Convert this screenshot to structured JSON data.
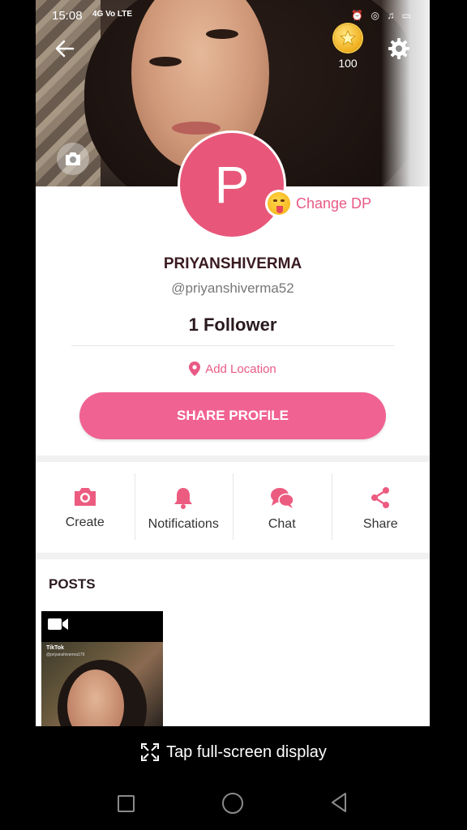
{
  "status": {
    "time": "15:08",
    "network": "4G Vo LTE",
    "right_icons": "⏰ ◎ ♫ ▭"
  },
  "coins": {
    "count": "100"
  },
  "profile": {
    "avatar_letter": "P",
    "change_dp_label": "Change DP",
    "name": "PRIYANSHIVERMA",
    "handle": "@priyanshiverma52",
    "followers": "1 Follower",
    "add_location": "Add Location",
    "share_profile": "SHARE PROFILE"
  },
  "actions": [
    {
      "label": "Create",
      "icon": "camera-icon"
    },
    {
      "label": "Notifications",
      "icon": "bell-icon"
    },
    {
      "label": "Chat",
      "icon": "chat-icon"
    },
    {
      "label": "Share",
      "icon": "share-icon"
    }
  ],
  "posts": {
    "title": "POSTS",
    "items": [
      {
        "watermark": "TikTok",
        "watermark_user": "@priyanshiverma179",
        "type": "video-icon"
      }
    ]
  },
  "fullscreen_hint": "Tap full-screen display",
  "colors": {
    "accent": "#f06292",
    "accent_text": "#e85a85",
    "avatar": "#e8577a",
    "title_dark": "#3a1b22"
  }
}
